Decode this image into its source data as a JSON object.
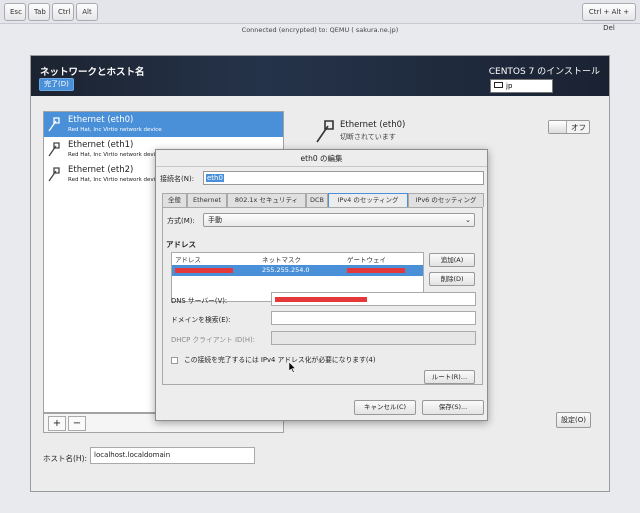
{
  "topbar": {
    "keys": [
      "Esc",
      "Tab",
      "Ctrl",
      "Alt"
    ],
    "combo_key": "Ctrl + Alt + Del"
  },
  "status": "Connected (encrypted) to: QEMU (                      sakura.ne.jp)",
  "header": {
    "title": "ネットワークとホスト名",
    "done_button": "完了(D)",
    "installer_title": "CENTOS 7 のインストール",
    "keyboard_layout": "jp"
  },
  "devices": [
    {
      "name": "Ethernet (eth0)",
      "description": "Red Hat, Inc Virtio network device"
    },
    {
      "name": "Ethernet (eth1)",
      "description": "Red Hat, Inc Virtio network device"
    },
    {
      "name": "Ethernet (eth2)",
      "description": "Red Hat, Inc Virtio network device"
    }
  ],
  "list_buttons": {
    "add": "+",
    "remove": "−"
  },
  "hostname": {
    "label": "ホスト名(H):",
    "value": "localhost.localdomain"
  },
  "summary": {
    "device_name": "Ethernet (eth0)",
    "state": "切断されています",
    "toggle_label": "オフ",
    "settings_button": "設定(O)"
  },
  "dialog": {
    "title": "eth0 の編集",
    "connection_name_label": "接続名(N):",
    "connection_name_value": "eth0",
    "tabs": [
      "全般",
      "Ethernet",
      "802.1x セキュリティ",
      "DCB",
      "IPv4 のセッティング",
      "IPv6 のセッティング"
    ],
    "active_tab": "IPv4 のセッティング",
    "method_label": "方式(M):",
    "method_value": "手動",
    "addresses_heading": "アドレス",
    "address_columns": [
      "アドレス",
      "ネットマスク",
      "ゲートウェイ"
    ],
    "address_row_netmask": "255.255.254.0",
    "add_button": "追加(A)",
    "delete_button": "削除(D)",
    "dns_label": "DNS サーバー(V):",
    "search_domains_label": "ドメインを検索(E):",
    "dhcp_client_id_label": "DHCP クライアント ID(H):",
    "require_ipv4_label": "この接続を完了するには IPv4 アドレス化が必要になります(4)",
    "routes_button": "ルート(R)…",
    "cancel_button": "キャンセル(C)",
    "save_button": "保存(S)..."
  }
}
